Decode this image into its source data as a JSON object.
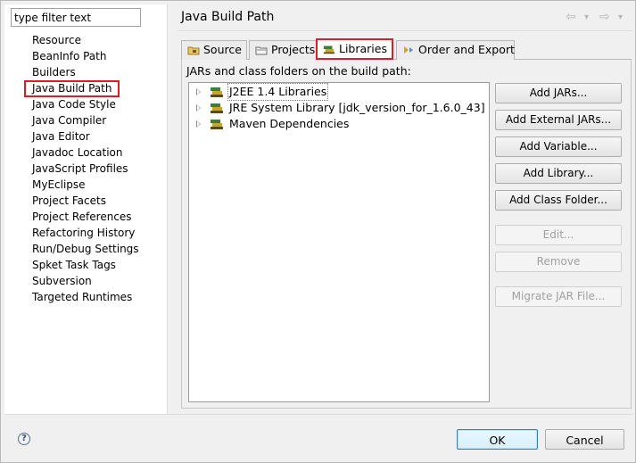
{
  "filter": {
    "value": "type filter text"
  },
  "sidebar": {
    "items": [
      {
        "label": "Resource"
      },
      {
        "label": "BeanInfo Path"
      },
      {
        "label": "Builders"
      },
      {
        "label": "Java Build Path",
        "selected": true
      },
      {
        "label": "Java Code Style"
      },
      {
        "label": "Java Compiler"
      },
      {
        "label": "Java Editor"
      },
      {
        "label": "Javadoc Location"
      },
      {
        "label": "JavaScript Profiles"
      },
      {
        "label": "MyEclipse"
      },
      {
        "label": "Project Facets"
      },
      {
        "label": "Project References"
      },
      {
        "label": "Refactoring History"
      },
      {
        "label": "Run/Debug Settings"
      },
      {
        "label": "Spket Task Tags"
      },
      {
        "label": "Subversion"
      },
      {
        "label": "Targeted Runtimes"
      }
    ]
  },
  "header": {
    "title": "Java Build Path"
  },
  "tabs": [
    {
      "label": "Source",
      "icon": "source-folder-icon"
    },
    {
      "label": "Projects",
      "icon": "projects-icon"
    },
    {
      "label": "Libraries",
      "icon": "libraries-icon",
      "active": true
    },
    {
      "label": "Order and Export",
      "icon": "order-export-icon"
    }
  ],
  "libraries": {
    "caption": "JARs and class folders on the build path:",
    "entries": [
      {
        "label": "J2EE 1.4 Libraries"
      },
      {
        "label": "JRE System Library [jdk_version_for_1.6.0_43]"
      },
      {
        "label": "Maven Dependencies"
      }
    ],
    "buttons": {
      "add_jars": "Add JARs...",
      "add_external_jars": "Add External JARs...",
      "add_variable": "Add Variable...",
      "add_library": "Add Library...",
      "add_class_folder": "Add Class Folder...",
      "edit": "Edit...",
      "remove": "Remove",
      "migrate_jar": "Migrate JAR File..."
    }
  },
  "footer": {
    "ok": "OK",
    "cancel": "Cancel",
    "help": "?"
  },
  "colors": {
    "highlight": "#d61f26",
    "default_button_border": "#3c7fb1"
  }
}
